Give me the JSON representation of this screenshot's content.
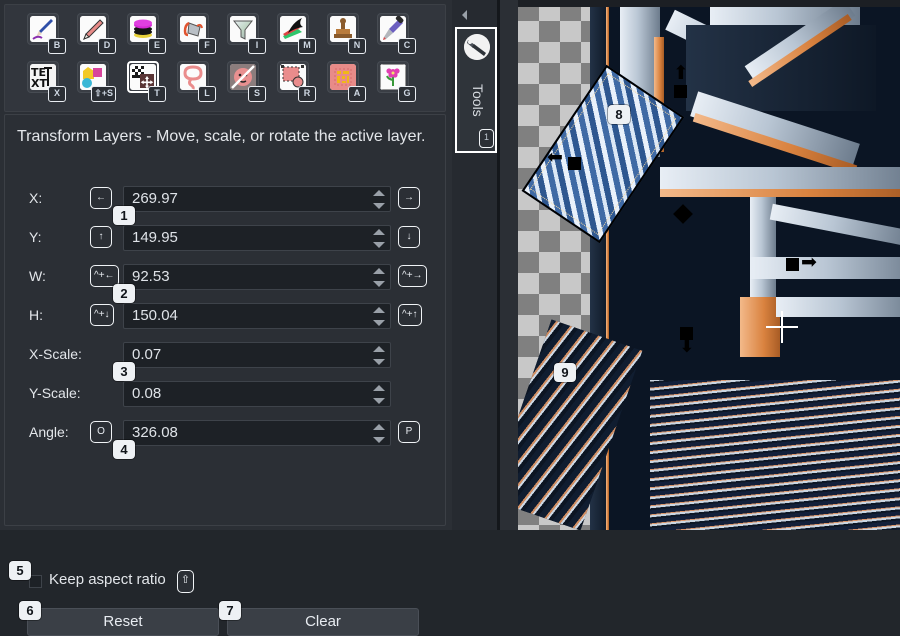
{
  "toolbar": {
    "rows": [
      [
        {
          "name": "paintbrush-tool",
          "key": "B",
          "icon": "paintbrush-icon"
        },
        {
          "name": "pencil-tool",
          "key": "D",
          "icon": "pencil-icon"
        },
        {
          "name": "eraser-tool",
          "key": "E",
          "icon": "stack-disc-icon"
        },
        {
          "name": "bucket-fill-tool",
          "key": "F",
          "icon": "bucket-fill-icon"
        },
        {
          "name": "filter-tool",
          "key": "I",
          "icon": "funnel-icon"
        },
        {
          "name": "smudge-tool",
          "key": "M",
          "icon": "smudge-icon"
        },
        {
          "name": "clone-stamp-tool",
          "key": "N",
          "icon": "stamp-icon"
        },
        {
          "name": "color-picker-tool",
          "key": "C",
          "icon": "eyedropper-icon"
        }
      ],
      [
        {
          "name": "text-tool",
          "key": "X",
          "icon": "text-icon"
        },
        {
          "name": "shapes-tool",
          "key": "⇧+S",
          "icon": "shapes-icon"
        },
        {
          "name": "transform-layers-tool",
          "key": "T",
          "icon": "transform-icon",
          "selected": true
        },
        {
          "name": "lasso-tool",
          "key": "L",
          "icon": "lasso-icon"
        },
        {
          "name": "smart-select-tool",
          "key": "S",
          "icon": "portrait-select-icon"
        },
        {
          "name": "rectangle-select-tool",
          "key": "R",
          "icon": "rect-select-icon"
        },
        {
          "name": "magic-wand-tool",
          "key": "A",
          "icon": "magic-wand-icon"
        },
        {
          "name": "gradient-tool",
          "key": "G",
          "icon": "flower-icon"
        }
      ]
    ]
  },
  "options": {
    "description": "Transform Layers - Move, scale, or rotate the active layer.",
    "fields": [
      {
        "label": "X:",
        "underline": "X",
        "value": "269.97",
        "left_key": "←",
        "right_key": "→",
        "badge": "1"
      },
      {
        "label": "Y:",
        "underline": "Y",
        "value": "149.95",
        "left_key": "↑",
        "right_key": "↓",
        "badge": null
      },
      {
        "label": "W:",
        "underline": "W",
        "value": "92.53",
        "left_key": "^+←",
        "right_key": "^+→",
        "badge": "2"
      },
      {
        "label": "H:",
        "underline": "H",
        "value": "150.04",
        "left_key": "^+↓",
        "right_key": "^+↑",
        "badge": null
      },
      {
        "label": "X-Scale:",
        "underline": "",
        "value": "0.07",
        "left_key": null,
        "right_key": null,
        "badge": "3"
      },
      {
        "label": "Y-Scale:",
        "underline": "",
        "value": "0.08",
        "left_key": null,
        "right_key": null,
        "badge": null
      },
      {
        "label": "Angle:",
        "underline": "A",
        "value": "326.08",
        "left_key": "O",
        "right_key": "P",
        "badge": "4"
      }
    ],
    "keep_aspect_label": "Keep aspect ratio",
    "keep_aspect_key": "⇧",
    "keep_aspect_checked": false,
    "keep_aspect_badge": "5",
    "reset_label": "Reset",
    "reset_badge": "6",
    "clear_label": "Clear",
    "clear_badge": "7"
  },
  "dock": {
    "collapse_icon": "chevron-left-icon",
    "tools_tab_label": "Tools",
    "tools_tab_key": "1",
    "tools_tab_icon": "wrench-icon"
  },
  "canvas": {
    "selection_badge": "8",
    "layer_badge": "9",
    "cursor": "crosshair-cursor",
    "handles": [
      "top",
      "left",
      "right",
      "bottom",
      "center-pivot"
    ]
  },
  "colors": {
    "panel_bg": "#2b2f35",
    "toolbar_bg": "#32363d",
    "input_bg": "#1d2126",
    "text": "#e3e6ea",
    "accent": "#ffffff",
    "badge_bg": "#eef1f4",
    "checker_light": "#c8c8c8",
    "checker_dark": "#808080"
  }
}
